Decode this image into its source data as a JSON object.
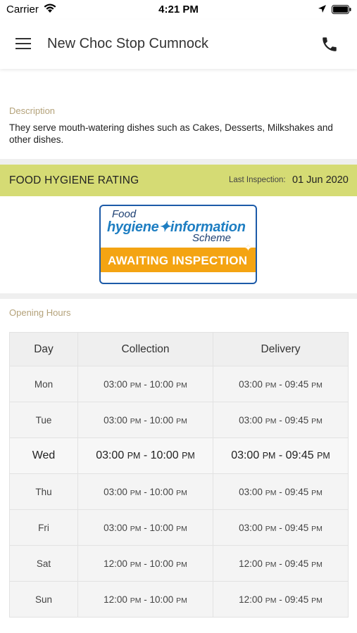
{
  "status_bar": {
    "carrier": "Carrier",
    "time": "4:21 PM"
  },
  "header": {
    "title": "New Choc Stop Cumnock",
    "menu_icon": "hamburger-menu-icon",
    "phone_icon": "phone-icon"
  },
  "description": {
    "label": "Description",
    "text": "They serve mouth-watering dishes such as Cakes, Desserts, Milkshakes and other dishes."
  },
  "hygiene": {
    "title": "FOOD HYGIENE RATING",
    "last_inspection_label": "Last Inspection:",
    "last_inspection_value": "01 Jun 2020",
    "badge": {
      "line1": "Food",
      "line2": "hygiene✦information",
      "line3": "Scheme",
      "status": "AWAITING INSPECTION"
    },
    "bar_color": "#d5db74",
    "badge_orange": "#f4a412"
  },
  "opening_hours": {
    "label": "Opening Hours",
    "columns": [
      "Day",
      "Collection",
      "Delivery"
    ],
    "rows": [
      {
        "day": "Mon",
        "collection": {
          "from": "03:00",
          "to": "10:00"
        },
        "delivery": {
          "from": "03:00",
          "to": "09:45"
        }
      },
      {
        "day": "Tue",
        "collection": {
          "from": "03:00",
          "to": "10:00"
        },
        "delivery": {
          "from": "03:00",
          "to": "09:45"
        }
      },
      {
        "day": "Wed",
        "collection": {
          "from": "03:00",
          "to": "10:00"
        },
        "delivery": {
          "from": "03:00",
          "to": "09:45"
        }
      },
      {
        "day": "Thu",
        "collection": {
          "from": "03:00",
          "to": "10:00"
        },
        "delivery": {
          "from": "03:00",
          "to": "09:45"
        }
      },
      {
        "day": "Fri",
        "collection": {
          "from": "03:00",
          "to": "10:00"
        },
        "delivery": {
          "from": "03:00",
          "to": "09:45"
        }
      },
      {
        "day": "Sat",
        "collection": {
          "from": "12:00",
          "to": "10:00"
        },
        "delivery": {
          "from": "12:00",
          "to": "09:45"
        }
      },
      {
        "day": "Sun",
        "collection": {
          "from": "12:00",
          "to": "10:00"
        },
        "delivery": {
          "from": "12:00",
          "to": "09:45"
        }
      }
    ],
    "current_day": "Wed",
    "meridiem": "PM",
    "separator": " - "
  }
}
